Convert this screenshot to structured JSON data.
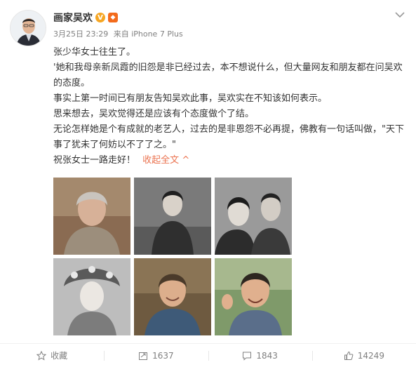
{
  "post": {
    "author": "画家吴欢",
    "time": "3月25日 23:29",
    "source": "来自 iPhone 7 Plus",
    "lines": [
      "张少华女士往生了。",
      "'她和我母亲新凤霞的旧怨是非已经过去，本不想说什么，但大量网友和朋友都在问吴欢的态度。",
      "事实上第一时间已有朋友告知吴欢此事，吴欢实在不知该如何表示。",
      "思来想去，吴欢觉得还是应该有个态度做个了结。",
      "无论怎样她是个有成就的老艺人，过去的是非恩怨不必再提，佛教有一句话叫做，\"天下事了犹未了何妨以不了了之。\""
    ],
    "last_line": "祝张女士一路走好！",
    "collapse_label": "收起全文",
    "collapse_arrow": "^"
  },
  "badges": {
    "verified": "V",
    "vip": "◆"
  },
  "actions": {
    "favorite_label": "收藏",
    "repost_count": "1637",
    "comment_count": "1843",
    "like_count": "14249"
  },
  "colors": {
    "link": "#eb7350",
    "verified": "#f6a623",
    "vip": "#f36b1c",
    "muted": "#808080"
  },
  "icons": [
    "chevron-down-icon",
    "star-icon",
    "repost-icon",
    "comment-icon",
    "like-icon"
  ],
  "photos": [
    "photo-elderly-woman-cardigan",
    "photo-young-woman-qipao",
    "photo-couple-portrait",
    "photo-opera-headdress",
    "photo-smiling-woman",
    "photo-elderly-woman-waving"
  ]
}
